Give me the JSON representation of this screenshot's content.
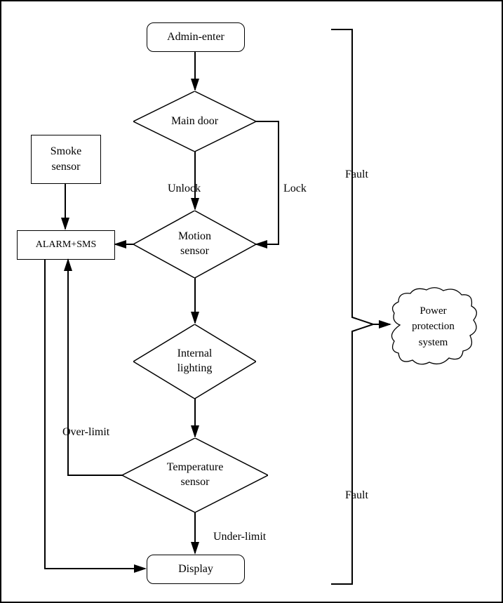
{
  "chart_data": {
    "type": "flowchart",
    "nodes": [
      {
        "id": "admin",
        "shape": "terminator",
        "label": "Admin-enter"
      },
      {
        "id": "maindoor",
        "shape": "decision",
        "label": "Main door"
      },
      {
        "id": "smoke",
        "shape": "process",
        "label": "Smoke sensor"
      },
      {
        "id": "alarm",
        "shape": "process",
        "label": "ALARM+SMS"
      },
      {
        "id": "motion",
        "shape": "decision",
        "label": "Motion sensor"
      },
      {
        "id": "lighting",
        "shape": "decision",
        "label": "Internal lighting"
      },
      {
        "id": "temperature",
        "shape": "decision",
        "label": "Temperature sensor"
      },
      {
        "id": "display",
        "shape": "terminator",
        "label": "Display"
      },
      {
        "id": "power",
        "shape": "cloud",
        "label": "Power protection system"
      }
    ],
    "edges": [
      {
        "from": "admin",
        "to": "maindoor",
        "label": ""
      },
      {
        "from": "maindoor",
        "to": "motion",
        "label": "Unlock"
      },
      {
        "from": "maindoor",
        "to": "motion",
        "label": "Lock",
        "via": "right"
      },
      {
        "from": "smoke",
        "to": "alarm",
        "label": ""
      },
      {
        "from": "motion",
        "to": "alarm",
        "label": ""
      },
      {
        "from": "motion",
        "to": "lighting",
        "label": ""
      },
      {
        "from": "lighting",
        "to": "temperature",
        "label": ""
      },
      {
        "from": "temperature",
        "to": "display",
        "label": "Under-limit"
      },
      {
        "from": "temperature",
        "to": "alarm",
        "label": "Over-limit",
        "via": "left"
      },
      {
        "from": "alarm",
        "to": "display",
        "label": "",
        "via": "bottom"
      },
      {
        "from": "bracket",
        "to": "power",
        "label": "Fault"
      }
    ]
  },
  "nodes": {
    "admin": "Admin-enter",
    "maindoor": "Main door",
    "smoke": "Smoke<br>sensor",
    "alarm": "ALARM+SMS",
    "motion": "Motion<br>sensor",
    "lighting": "Internal<br>lighting",
    "temperature": "Temperature<br>sensor",
    "display": "Display",
    "power": "Power<br>protection<br>system"
  },
  "labels": {
    "unlock": "Unlock",
    "lock": "Lock",
    "overlimit": "Over-limit",
    "underlimit": "Under-limit",
    "fault1": "Fault",
    "fault2": "Fault"
  }
}
